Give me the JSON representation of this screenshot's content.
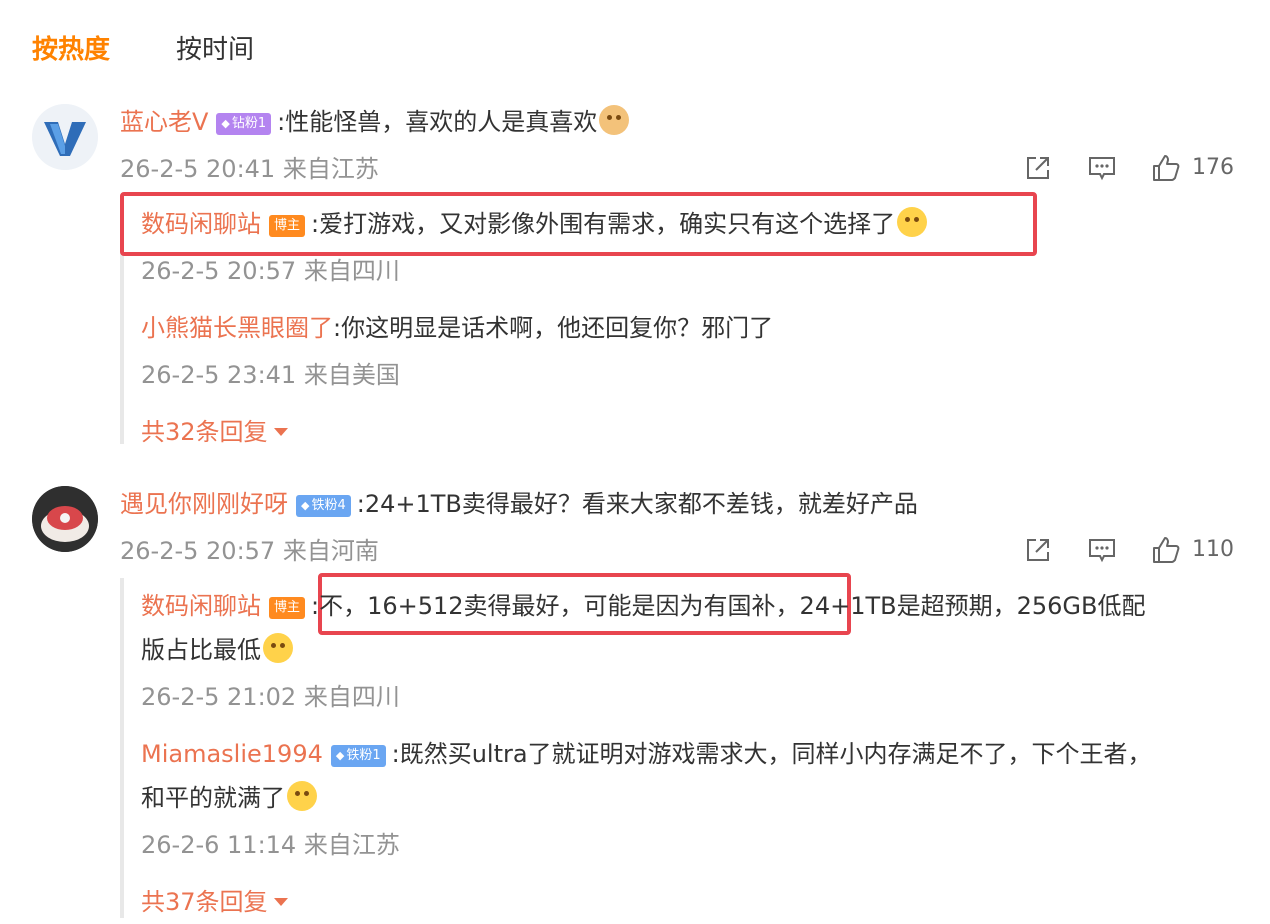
{
  "tabs": [
    {
      "label": "按热度",
      "active": true
    },
    {
      "label": "按时间",
      "active": false
    }
  ],
  "comments": [
    {
      "user": "蓝心老V",
      "badge": "钻粉1",
      "text": ":性能怪兽，喜欢的人是真喜欢",
      "meta": "26-2-5 20:41 来自江苏",
      "likes": "176",
      "replies": [
        {
          "user": "数码闲聊站",
          "badge": "博主",
          "text": ":爱打游戏，又对影像外围有需求，确实只有这个选择了",
          "meta": "26-2-5 20:57 来自四川"
        },
        {
          "user": "小熊猫长黑眼圈了",
          "text": ":你这明显是话术啊，他还回复你？邪门了",
          "meta": "26-2-5 23:41 来自美国"
        }
      ],
      "more": "共32条回复"
    },
    {
      "user": "遇见你刚刚好呀",
      "badge": "铁粉4",
      "text": ":24+1TB卖得最好？看来大家都不差钱，就差好产品",
      "meta": "26-2-5 20:57 来自河南",
      "likes": "110",
      "replies": [
        {
          "user": "数码闲聊站",
          "badge": "博主",
          "text_line1": ":不，16+512卖得最好，可能是因为有国补，24+1TB是超预期，256GB低配",
          "text_line2": "版占比最低",
          "meta": "26-2-5 21:02 来自四川"
        },
        {
          "user": "Miamaslie1994",
          "badge": "铁粉1",
          "text_line1": ":既然买ultra了就证明对游戏需求大，同样小内存满足不了，下个王者，",
          "text_line2": "和平的就满了",
          "meta": "26-2-6 11:14 来自江苏"
        }
      ],
      "more": "共37条回复"
    }
  ],
  "colors": {
    "accent": "#ff8200",
    "name": "#eb7350",
    "meta": "#939393",
    "highlight": "#e8454f"
  },
  "icons": [
    "share-icon",
    "comment-icon",
    "like-icon",
    "caret-down-icon",
    "diamond-icon"
  ]
}
